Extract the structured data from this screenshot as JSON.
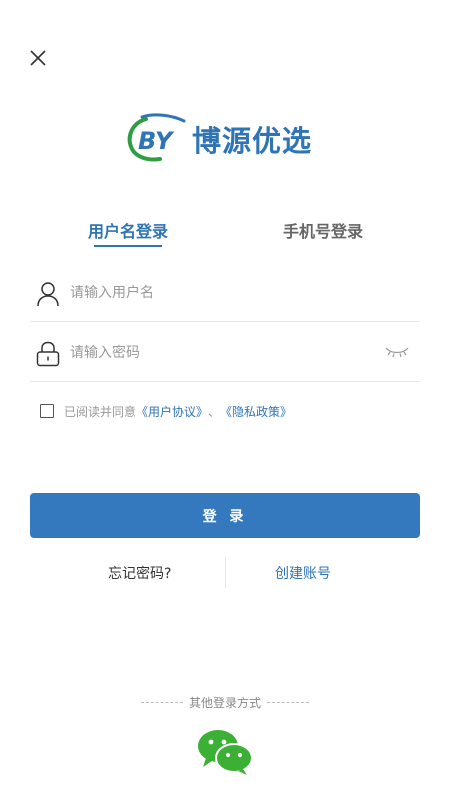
{
  "logo": {
    "mark": "BY",
    "text": "博源优选"
  },
  "tabs": [
    {
      "label": "用户名登录",
      "active": true
    },
    {
      "label": "手机号登录",
      "active": false
    }
  ],
  "username": {
    "placeholder": "请输入用户名",
    "value": ""
  },
  "password": {
    "placeholder": "请输入密码",
    "value": ""
  },
  "agreement": {
    "prefix": "已阅读并同意",
    "user_agreement": "《用户协议》",
    "separator": "、",
    "privacy_policy": "《隐私政策》"
  },
  "login_button": "登 录",
  "forgot_password": "忘记密码?",
  "create_account": "创建账号",
  "other_login_label": "其他登录方式",
  "colors": {
    "accent": "#3479bd",
    "brand_green": "#2e9d43",
    "wechat_green": "#3cb034"
  }
}
